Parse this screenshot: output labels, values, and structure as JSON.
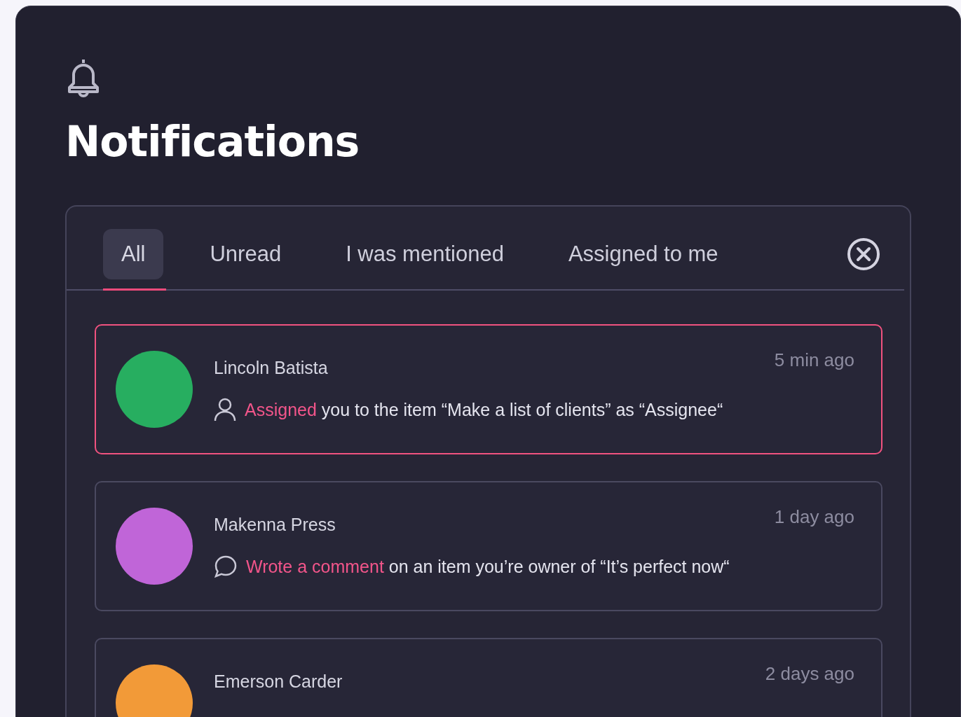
{
  "title": "Notifications",
  "tabs": [
    {
      "label": "All",
      "selected": true
    },
    {
      "label": "Unread",
      "selected": false
    },
    {
      "label": "I was mentioned",
      "selected": false
    },
    {
      "label": "Assigned to me",
      "selected": false
    }
  ],
  "notifications": [
    {
      "name": "Lincoln Batista",
      "time": "5 min ago",
      "kind": "assigned",
      "action": "Assigned",
      "detail": " you to the item “Make a list of clients” as “Assignee“",
      "selected": true,
      "color": "#27ae60"
    },
    {
      "name": "Makenna Press",
      "time": "1 day ago",
      "kind": "comment",
      "action": "Wrote a comment",
      "detail": " on an item you’re owner of “It’s perfect now“",
      "selected": false,
      "color": "#c065d8"
    },
    {
      "name": "Emerson Carder",
      "time": "2 days ago",
      "selected": false,
      "color": "#f29a38"
    }
  ]
}
